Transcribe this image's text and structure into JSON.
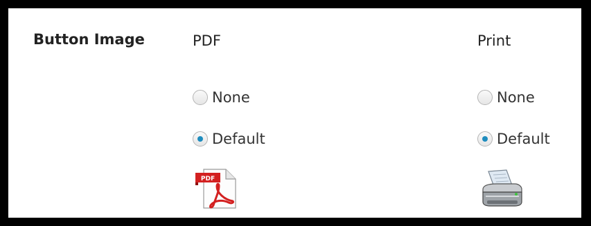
{
  "row_label": "Button Image",
  "columns": [
    {
      "title": "PDF",
      "options": [
        {
          "label": "None",
          "checked": false
        },
        {
          "label": "Default",
          "checked": true
        }
      ],
      "icon": "pdf-file-icon",
      "icon_text": "PDF"
    },
    {
      "title": "Print",
      "options": [
        {
          "label": "None",
          "checked": false
        },
        {
          "label": "Default",
          "checked": true
        }
      ],
      "icon": "printer-icon"
    }
  ],
  "colors": {
    "frame": "#000000",
    "radio_dot": "#1e8cbe",
    "pdf_red": "#d32020"
  }
}
